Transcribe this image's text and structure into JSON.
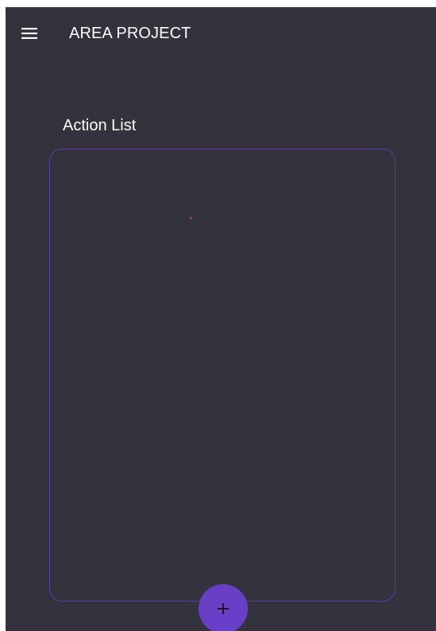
{
  "app_bar": {
    "title": "AREA PROJECT",
    "menu_icon": "hamburger-menu-icon"
  },
  "main": {
    "section_title": "Action List"
  },
  "fab": {
    "icon": "plus-icon",
    "label": "+"
  },
  "colors": {
    "background": "#33323d",
    "accent": "#6a3fc7",
    "list_border": "#5a3fa8",
    "text": "#ffffff"
  }
}
